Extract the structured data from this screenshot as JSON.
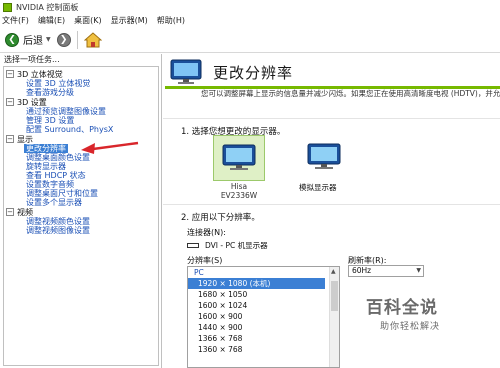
{
  "window": {
    "title": "NVIDIA 控制面板"
  },
  "menu": [
    "文件(F)",
    "编辑(E)",
    "桌面(K)",
    "显示器(M)",
    "帮助(H)"
  ],
  "toolbar": {
    "back_label": "后退"
  },
  "left": {
    "task_header": "选择一项任务...",
    "categories": [
      {
        "label": "3D 立体视觉",
        "items": [
          "设置 3D 立体视觉",
          "查看游戏分级"
        ]
      },
      {
        "label": "3D 设置",
        "items": [
          "通过预览调整图像设置",
          "管理 3D 设置",
          "配置 Surround、PhysX"
        ]
      },
      {
        "label": "显示",
        "items": [
          "更改分辨率",
          "调整桌面颜色设置",
          "旋转显示器",
          "查看 HDCP 状态",
          "设置数字音频",
          "调整桌面尺寸和位置",
          "设置多个显示器"
        ]
      },
      {
        "label": "视频",
        "items": [
          "调整视频颜色设置",
          "调整视频图像设置"
        ]
      }
    ]
  },
  "main": {
    "title": "更改分辨率",
    "description": "您可以调整屏幕上显示的信息量并减少闪烁。如果您正在使用高清晰度电视 (HDTV)，并允许",
    "section1": "1. 选择您想更改的显示器。",
    "displays": [
      {
        "label": "Hisa EV2336W",
        "selected": true
      },
      {
        "label": "模拟显示器",
        "selected": false
      }
    ],
    "section2": "2. 应用以下分辨率。",
    "connector_label": "连接器(N):",
    "connector_value": "DVI - PC 机显示器",
    "resolution_label": "分辨率(S)",
    "resolution_group": "PC",
    "resolutions": [
      "1920 × 1080 (本机)",
      "1680 × 1050",
      "1600 × 1024",
      "1600 × 900",
      "1440 × 900",
      "1366 × 768",
      "1360 × 768"
    ],
    "refresh_label": "刷新率(R):",
    "refresh_value": "60Hz"
  },
  "watermark": {
    "main": "百科全说",
    "sub": "助你轻松解决"
  },
  "colors": {
    "nvidia_green": "#76b900",
    "selection_blue": "#3b7fd4",
    "link_blue": "#1a4fb5",
    "annotation_red": "#d9262b"
  }
}
